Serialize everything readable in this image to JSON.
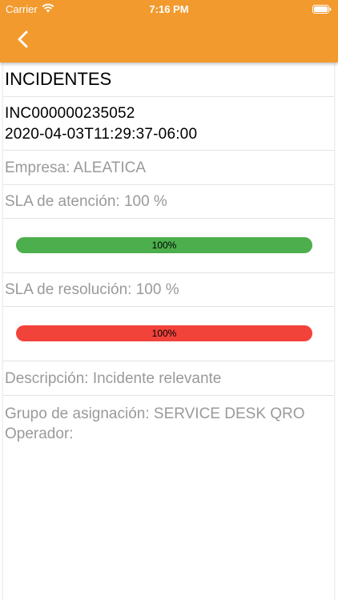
{
  "status_bar": {
    "carrier": "Carrier",
    "time": "7:16 PM",
    "icons": [
      "wifi-icon",
      "battery-icon"
    ]
  },
  "nav": {
    "back_icon": "chevron-left-icon",
    "color": "#f29a2e"
  },
  "incident": {
    "section_title": "INCIDENTES",
    "number": "INC000000235052",
    "timestamp": "2020-04-03T11:29:37-06:00",
    "empresa": "Empresa: ALEATICA",
    "sla_atencion_label": "SLA de atención: 100 %",
    "sla_atencion_progress": {
      "value": 100,
      "text": "100%",
      "color": "#4cae4c"
    },
    "sla_resolucion_label": "SLA de resolución: 100 %",
    "sla_resolucion_progress": {
      "value": 100,
      "text": "100%",
      "color": "#f2433b"
    },
    "descripcion": "Descripción: Incidente relevante",
    "grupo": "Grupo de asignación: SERVICE DESK QRO",
    "operador": "Operador:"
  }
}
